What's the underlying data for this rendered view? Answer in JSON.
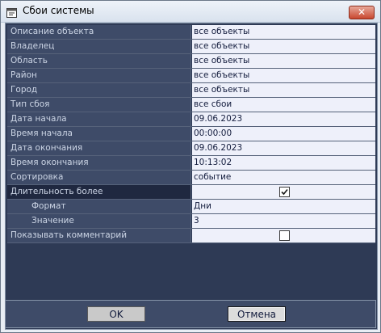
{
  "window": {
    "title": "Сбои системы",
    "close_symbol": "✕"
  },
  "properties": [
    {
      "label": "Описание объекта",
      "value": "все объекты"
    },
    {
      "label": "Владелец",
      "value": "все объекты"
    },
    {
      "label": "Область",
      "value": "все объекты"
    },
    {
      "label": "Район",
      "value": "все объекты"
    },
    {
      "label": "Город",
      "value": "все объекты"
    },
    {
      "label": "Тип сбоя",
      "value": "все сбои"
    },
    {
      "label": "Дата начала",
      "value": "09.06.2023"
    },
    {
      "label": "Время начала",
      "value": "00:00:00"
    },
    {
      "label": "Дата окончания",
      "value": "09.06.2023"
    },
    {
      "label": "Время окончания",
      "value": "10:13:02"
    },
    {
      "label": "Сортировка",
      "value": "событие"
    },
    {
      "label": "Длительность более",
      "checked": true
    },
    {
      "label": "Формат",
      "value": "Дни"
    },
    {
      "label": "Значение",
      "value": "3"
    },
    {
      "label": "Показывать комментарий",
      "checked": false
    }
  ],
  "buttons": {
    "ok": "OK",
    "cancel": "Отмена"
  }
}
